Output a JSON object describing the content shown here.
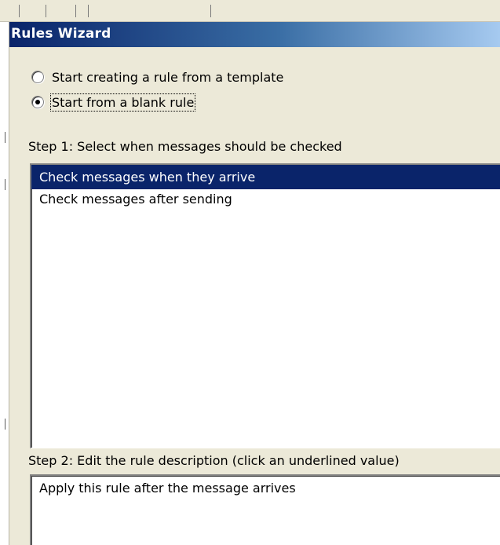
{
  "dialog": {
    "title": "Rules Wizard"
  },
  "options": [
    {
      "label": "Start creating a rule from a template",
      "checked": false
    },
    {
      "label": "Start from a blank rule",
      "checked": true
    }
  ],
  "step1": {
    "label": "Step 1: Select when messages should be checked",
    "items": [
      {
        "label": "Check messages when they arrive",
        "selected": true
      },
      {
        "label": "Check messages after sending",
        "selected": false
      }
    ]
  },
  "step2": {
    "label": "Step 2: Edit the rule description (click an underlined value)",
    "description": "Apply this rule after the message arrives"
  },
  "colors": {
    "selection": "#0a246a",
    "dialog_bg": "#ece9d8",
    "title_gradient_start": "#0a246a",
    "title_gradient_end": "#a6caf0"
  }
}
